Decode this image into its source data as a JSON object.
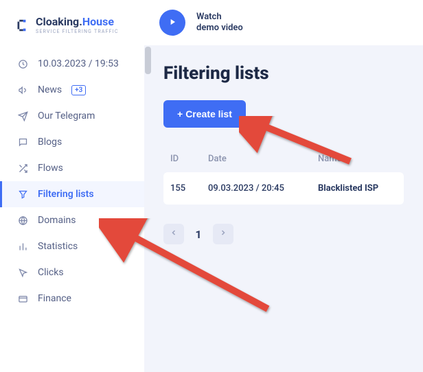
{
  "brand": {
    "name_primary": "Cloaking.",
    "name_secondary": "House",
    "tagline": "SERVICE FILTERING TRAFFIC"
  },
  "sidebar": {
    "datetime": "10.03.2023 / 19:53",
    "news_badge": "+3",
    "items": [
      {
        "label": "News"
      },
      {
        "label": "Our Telegram"
      },
      {
        "label": "Blogs"
      },
      {
        "label": "Flows"
      },
      {
        "label": "Filtering lists"
      },
      {
        "label": "Domains"
      },
      {
        "label": "Statistics"
      },
      {
        "label": "Clicks"
      },
      {
        "label": "Finance"
      }
    ]
  },
  "topbar": {
    "watch_line1": "Watch",
    "watch_line2": "demo video"
  },
  "page": {
    "title": "Filtering lists",
    "create_label": "Create list",
    "columns": {
      "id": "ID",
      "date": "Date",
      "name": "Name"
    },
    "rows": [
      {
        "id": "155",
        "date": "09.03.2023 / 20:45",
        "name": "Blacklisted ISP"
      }
    ],
    "pager": {
      "current": "1"
    }
  }
}
